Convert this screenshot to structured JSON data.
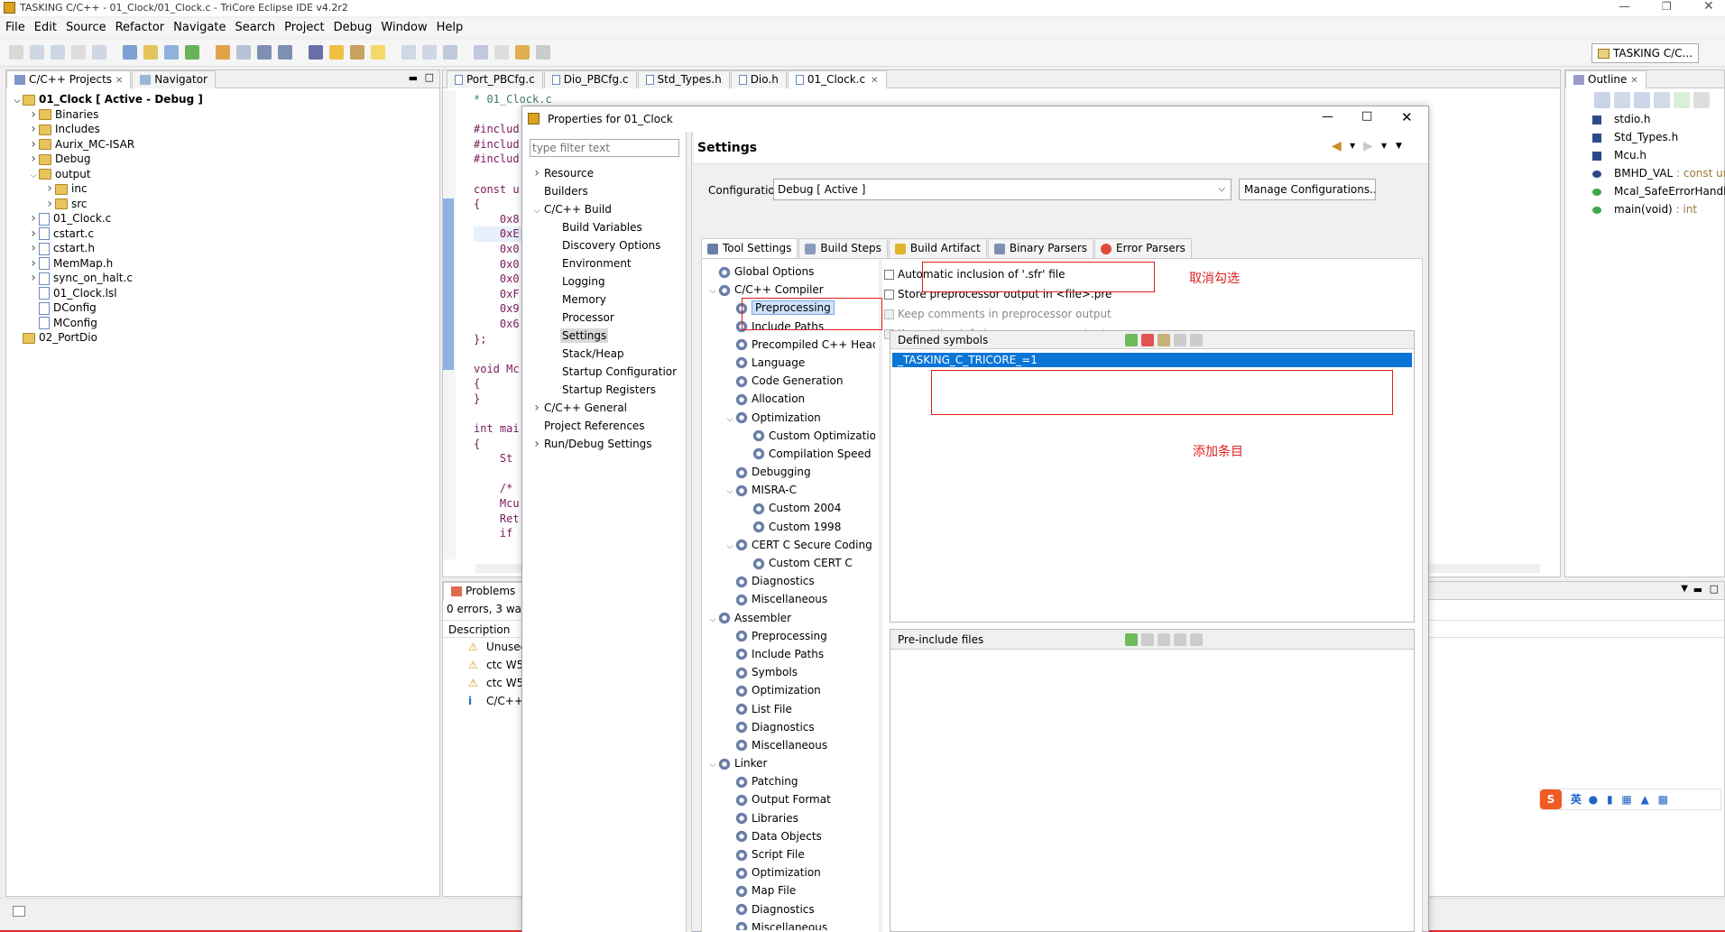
{
  "title": "TASKING C/C++ - 01_Clock/01_Clock.c - TriCore Eclipse IDE v4.2r2",
  "menu": [
    "File",
    "Edit",
    "Source",
    "Refactor",
    "Navigate",
    "Search",
    "Project",
    "Debug",
    "Window",
    "Help"
  ],
  "perspective": "TASKING C/C...",
  "left_tabs": {
    "projects": "C/C++ Projects",
    "navigator": "Navigator"
  },
  "project_tree": [
    {
      "label": "01_Clock [ Active - Debug ]",
      "depth": 0,
      "twist": "v",
      "bold": true
    },
    {
      "label": "Binaries",
      "depth": 1,
      "twist": ">"
    },
    {
      "label": "Includes",
      "depth": 1,
      "twist": ">"
    },
    {
      "label": "Aurix_MC-ISAR",
      "depth": 1,
      "twist": ">"
    },
    {
      "label": "Debug",
      "depth": 1,
      "twist": ">"
    },
    {
      "label": "output",
      "depth": 1,
      "twist": "v"
    },
    {
      "label": "inc",
      "depth": 2,
      "twist": ">"
    },
    {
      "label": "src",
      "depth": 2,
      "twist": ">"
    },
    {
      "label": "01_Clock.c",
      "depth": 1,
      "twist": ">"
    },
    {
      "label": "cstart.c",
      "depth": 1,
      "twist": ">"
    },
    {
      "label": "cstart.h",
      "depth": 1,
      "twist": ">"
    },
    {
      "label": "MemMap.h",
      "depth": 1,
      "twist": ">"
    },
    {
      "label": "sync_on_halt.c",
      "depth": 1,
      "twist": ">"
    },
    {
      "label": "01_Clock.lsl",
      "depth": 1,
      "twist": ""
    },
    {
      "label": "DConfig",
      "depth": 1,
      "twist": ""
    },
    {
      "label": "MConfig",
      "depth": 1,
      "twist": ""
    },
    {
      "label": "02_PortDio",
      "depth": 0,
      "twist": ""
    }
  ],
  "editor_tabs": [
    "Port_PBCfg.c",
    "Dio_PBCfg.c",
    "Std_Types.h",
    "Dio.h",
    "01_Clock.c"
  ],
  "code_lines": [
    "* 01_Clock.c",
    "",
    "#includ",
    "#includ",
    "#includ",
    "",
    "const u",
    "{",
    "    0x8",
    "    0xE",
    "    0x0",
    "    0x0",
    "    0x0",
    "    0xF",
    "    0x9",
    "    0x6",
    "};",
    "",
    "void Mc",
    "{",
    "}",
    "",
    "int mai",
    "{",
    "    St",
    "",
    "    /*",
    "    Mcu",
    "    Ret",
    "    if"
  ],
  "outline": {
    "tab": "Outline",
    "items": [
      {
        "label": "stdio.h",
        "type": ""
      },
      {
        "label": "Std_Types.h",
        "type": ""
      },
      {
        "label": "Mcu.h",
        "type": ""
      },
      {
        "label": "BMHD_VAL",
        "type": " : const ur"
      },
      {
        "label": "Mcal_SafeErrorHandl",
        "type": ""
      },
      {
        "label": "main(void)",
        "type": " : int"
      }
    ]
  },
  "problems": {
    "tab": "Problems",
    "summary": "0 errors, 3 war",
    "col": "Description",
    "rows": [
      "Unused",
      "ctc W50",
      "ctc W50",
      "C/C++"
    ]
  },
  "dialog": {
    "title": "Properties for 01_Clock",
    "filter_placeholder": "type filter text",
    "nav": [
      {
        "label": "Resource",
        "depth": 0,
        "twist": ">"
      },
      {
        "label": "Builders",
        "depth": 0,
        "twist": ""
      },
      {
        "label": "C/C++ Build",
        "depth": 0,
        "twist": "v"
      },
      {
        "label": "Build Variables",
        "depth": 1,
        "twist": ""
      },
      {
        "label": "Discovery Options",
        "depth": 1,
        "twist": ""
      },
      {
        "label": "Environment",
        "depth": 1,
        "twist": ""
      },
      {
        "label": "Logging",
        "depth": 1,
        "twist": ""
      },
      {
        "label": "Memory",
        "depth": 1,
        "twist": ""
      },
      {
        "label": "Processor",
        "depth": 1,
        "twist": ""
      },
      {
        "label": "Settings",
        "depth": 1,
        "twist": "",
        "selected": true
      },
      {
        "label": "Stack/Heap",
        "depth": 1,
        "twist": ""
      },
      {
        "label": "Startup Configuratior",
        "depth": 1,
        "twist": ""
      },
      {
        "label": "Startup Registers",
        "depth": 1,
        "twist": ""
      },
      {
        "label": "C/C++ General",
        "depth": 0,
        "twist": ">"
      },
      {
        "label": "Project References",
        "depth": 0,
        "twist": ""
      },
      {
        "label": "Run/Debug Settings",
        "depth": 0,
        "twist": ">"
      }
    ],
    "heading": "Settings",
    "config_label": "Configuration:",
    "config_value": "Debug  [ Active ]",
    "manage_btn": "Manage Configurations...",
    "tool_tabs": [
      "Tool Settings",
      "Build Steps",
      "Build Artifact",
      "Binary Parsers",
      "Error Parsers"
    ],
    "settings_tree": [
      {
        "label": "Global Options",
        "depth": 0,
        "twist": ""
      },
      {
        "label": "C/C++ Compiler",
        "depth": 0,
        "twist": "v"
      },
      {
        "label": "Preprocessing",
        "depth": 1,
        "twist": "",
        "selected": true
      },
      {
        "label": "Include Paths",
        "depth": 1,
        "twist": ""
      },
      {
        "label": "Precompiled C++ Headers",
        "depth": 1,
        "twist": ""
      },
      {
        "label": "Language",
        "depth": 1,
        "twist": ""
      },
      {
        "label": "Code Generation",
        "depth": 1,
        "twist": ""
      },
      {
        "label": "Allocation",
        "depth": 1,
        "twist": ""
      },
      {
        "label": "Optimization",
        "depth": 1,
        "twist": "v"
      },
      {
        "label": "Custom Optimization",
        "depth": 2,
        "twist": ""
      },
      {
        "label": "Compilation Speed",
        "depth": 2,
        "twist": ""
      },
      {
        "label": "Debugging",
        "depth": 1,
        "twist": ""
      },
      {
        "label": "MISRA-C",
        "depth": 1,
        "twist": "v"
      },
      {
        "label": "Custom 2004",
        "depth": 2,
        "twist": ""
      },
      {
        "label": "Custom 1998",
        "depth": 2,
        "twist": ""
      },
      {
        "label": "CERT C Secure Coding",
        "depth": 1,
        "twist": "v"
      },
      {
        "label": "Custom CERT C",
        "depth": 2,
        "twist": ""
      },
      {
        "label": "Diagnostics",
        "depth": 1,
        "twist": ""
      },
      {
        "label": "Miscellaneous",
        "depth": 1,
        "twist": ""
      },
      {
        "label": "Assembler",
        "depth": 0,
        "twist": "v"
      },
      {
        "label": "Preprocessing",
        "depth": 1,
        "twist": ""
      },
      {
        "label": "Include Paths",
        "depth": 1,
        "twist": ""
      },
      {
        "label": "Symbols",
        "depth": 1,
        "twist": ""
      },
      {
        "label": "Optimization",
        "depth": 1,
        "twist": ""
      },
      {
        "label": "List File",
        "depth": 1,
        "twist": ""
      },
      {
        "label": "Diagnostics",
        "depth": 1,
        "twist": ""
      },
      {
        "label": "Miscellaneous",
        "depth": 1,
        "twist": ""
      },
      {
        "label": "Linker",
        "depth": 0,
        "twist": "v"
      },
      {
        "label": "Patching",
        "depth": 1,
        "twist": ""
      },
      {
        "label": "Output Format",
        "depth": 1,
        "twist": ""
      },
      {
        "label": "Libraries",
        "depth": 1,
        "twist": ""
      },
      {
        "label": "Data Objects",
        "depth": 1,
        "twist": ""
      },
      {
        "label": "Script File",
        "depth": 1,
        "twist": ""
      },
      {
        "label": "Optimization",
        "depth": 1,
        "twist": ""
      },
      {
        "label": "Map File",
        "depth": 1,
        "twist": ""
      },
      {
        "label": "Diagnostics",
        "depth": 1,
        "twist": ""
      },
      {
        "label": "Miscellaneous",
        "depth": 1,
        "twist": ""
      }
    ],
    "options": [
      {
        "label": "Automatic inclusion of '.sfr' file",
        "enabled": true
      },
      {
        "label": "Store preprocessor output in <file>.pre",
        "enabled": true
      },
      {
        "label": "Keep comments in preprocessor output",
        "enabled": false
      },
      {
        "label": "Keep #line info in preprocessor output",
        "enabled": false
      }
    ],
    "defined_symbols_label": "Defined symbols",
    "symbol": "_TASKING_C_TRICORE_=1",
    "preinclude_label": "Pre-include files"
  },
  "annotations": {
    "uncheck": "取消勾选",
    "add_entry": "添加条目"
  },
  "ime": "英"
}
